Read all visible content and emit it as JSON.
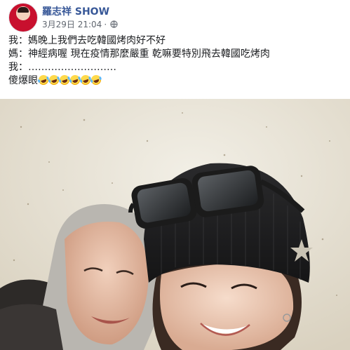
{
  "post": {
    "author": "羅志祥 SHOW",
    "timestamp": "3月29日 21:04",
    "separator": "·",
    "privacy_icon": "globe-icon",
    "lines": [
      "我：媽晚上我們去吃韓國烤肉好不好",
      "媽：神經病喔 現在疫情那麼嚴重 乾嘛要特別飛去韓國吃烤肉",
      "我：………………………",
      "傻爆眼"
    ],
    "emoji": [
      "🤣",
      "🤣",
      "🤣",
      "🤣",
      "🤣",
      "🤣"
    ]
  },
  "colors": {
    "author_link": "#385898",
    "meta_text": "#616770",
    "body_text": "#1c1e21"
  }
}
